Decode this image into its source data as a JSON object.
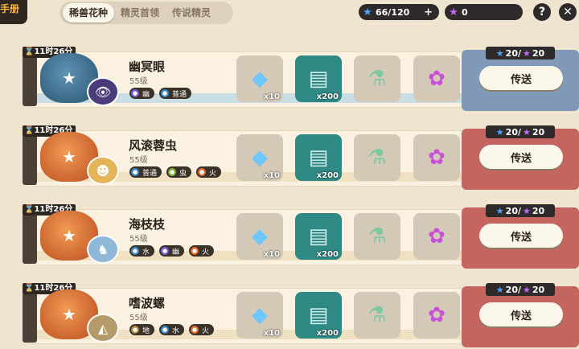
{
  "header": {
    "handbook_label": "手册",
    "tabs": [
      {
        "label": "稀兽花种",
        "active": true
      },
      {
        "label": "精灵首领",
        "active": false
      },
      {
        "label": "传说精灵",
        "active": false
      }
    ],
    "currency_blue": {
      "value": "66/120",
      "plus": "+",
      "icon": "blue-star-icon"
    },
    "currency_purple": {
      "value": "0",
      "icon": "purple-star-icon"
    },
    "help_label": "?",
    "close_label": "✕"
  },
  "common": {
    "send_label": "传送",
    "cost_blue": "20/",
    "cost_purple": "20",
    "item_qty": [
      "x10",
      "x200"
    ],
    "colors": {
      "panel_blue": "#8099b8",
      "panel_red": "#c46560",
      "button_bg": "#fbf6ea"
    }
  },
  "rows": [
    {
      "timer": "11时26分",
      "name": "幽冥眼",
      "level": "55级",
      "sack_color": "blue",
      "panel_color": "blue",
      "badges": [
        {
          "label": "幽",
          "color": "#7a5bd6"
        },
        {
          "label": "普通",
          "color": "#3a89c9"
        }
      ]
    },
    {
      "timer": "11时26分",
      "name": "风滚蓉虫",
      "level": "55级",
      "sack_color": "orange",
      "panel_color": "red",
      "badges": [
        {
          "label": "普通",
          "color": "#3a89c9"
        },
        {
          "label": "虫",
          "color": "#7fb23a"
        },
        {
          "label": "火",
          "color": "#e66a2c"
        }
      ]
    },
    {
      "timer": "11时26分",
      "name": "海枝枝",
      "level": "55级",
      "sack_color": "orange",
      "panel_color": "red",
      "badges": [
        {
          "label": "水",
          "color": "#3a89c9"
        },
        {
          "label": "幽",
          "color": "#7a5bd6"
        },
        {
          "label": "火",
          "color": "#e66a2c"
        }
      ]
    },
    {
      "timer": "11时26分",
      "name": "嗜波螺",
      "level": "55级",
      "sack_color": "orange",
      "panel_color": "red",
      "badges": [
        {
          "label": "地",
          "color": "#b08a4a"
        },
        {
          "label": "水",
          "color": "#3a89c9"
        },
        {
          "label": "火",
          "color": "#e66a2c"
        }
      ]
    }
  ]
}
